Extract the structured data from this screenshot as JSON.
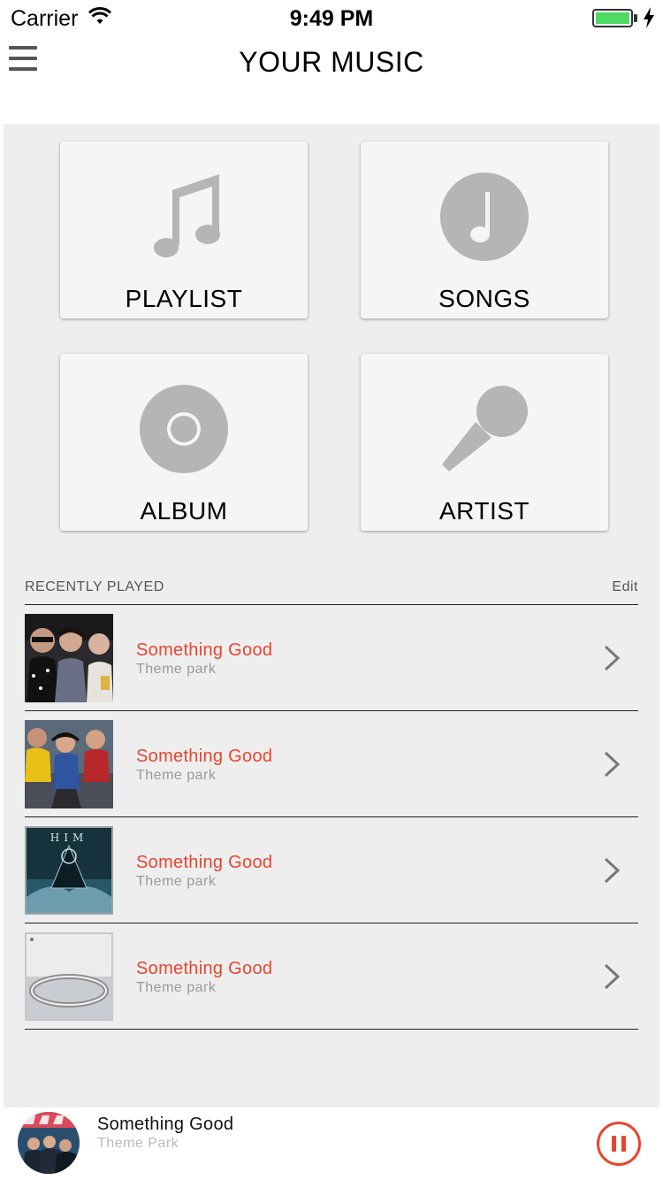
{
  "status_bar": {
    "carrier": "Carrier",
    "time": "9:49 PM",
    "battery_level": 1.0,
    "battery_color": "#4cd964"
  },
  "nav": {
    "title": "YOUR MUSIC",
    "menu_icon": "hamburger-menu-icon"
  },
  "categories": [
    {
      "label": "PLAYLIST",
      "icon": "music-note-icon"
    },
    {
      "label": "SONGS",
      "icon": "song-circle-icon"
    },
    {
      "label": "ALBUM",
      "icon": "disc-icon"
    },
    {
      "label": "ARTIST",
      "icon": "microphone-icon"
    }
  ],
  "recent": {
    "title": "RECENTLY PLAYED",
    "edit_label": "Edit",
    "items": [
      {
        "title": "Something Good",
        "subtitle": "Theme park",
        "art": "band-photo-album-art"
      },
      {
        "title": "Something Good",
        "subtitle": "Theme park",
        "art": "band-photo-album-art"
      },
      {
        "title": "Something Good",
        "subtitle": "Theme park",
        "art": "dark-light-album-art"
      },
      {
        "title": "Something Good",
        "subtitle": "Theme park",
        "art": "ring-album-art"
      }
    ]
  },
  "player": {
    "title": "Something Good",
    "subtitle": "Theme Park",
    "state_icon": "pause-icon"
  },
  "colors": {
    "accent": "#e8452e",
    "background": "#eeeeee",
    "card": "#f5f5f5",
    "icon_gray": "#b5b5b5"
  }
}
